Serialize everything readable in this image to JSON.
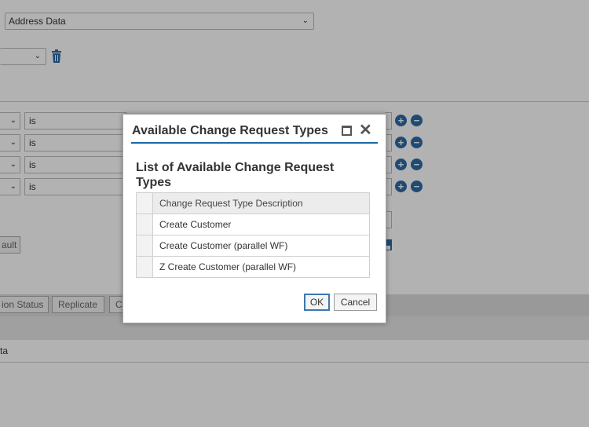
{
  "background": {
    "address_select": "Address Data",
    "condition_operator": "is",
    "conditions": [
      "is",
      "is",
      "is",
      "is"
    ],
    "default_button": "ault",
    "toolbar_buttons": [
      "ion Status",
      "Replicate",
      "C"
    ],
    "list_row_text": "ta"
  },
  "dialog": {
    "title": "Available Change Request Types",
    "subtitle": "List of Available Change Request Types",
    "table": {
      "column_header": "Change Request Type Description",
      "rows": [
        "Create Customer",
        "Create Customer (parallel WF)",
        "Z Create Customer (parallel WF)"
      ]
    },
    "ok_label": "OK",
    "cancel_label": "Cancel"
  },
  "colors": {
    "accent": "#1a6aa6",
    "icon_blue": "#2d6ba6",
    "overlay": "rgba(0,0,0,0.30)"
  }
}
